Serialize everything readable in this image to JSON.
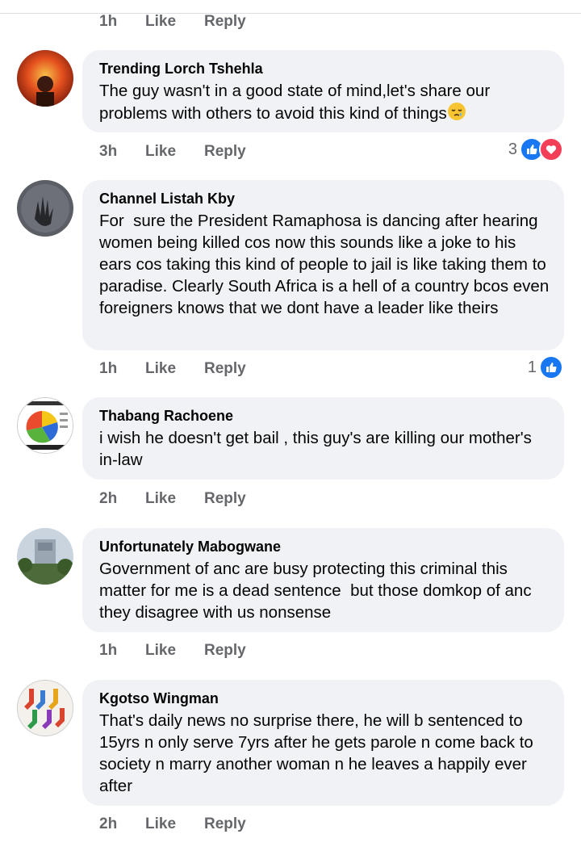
{
  "labels": {
    "like": "Like",
    "reply": "Reply"
  },
  "top_meta": {
    "time": "1h"
  },
  "comments": [
    {
      "author": "Trending Lorch Tshehla",
      "text": "The guy wasn't in a good state of mind,let's share our problems with others to avoid this kind of things",
      "time": "3h",
      "reaction_count": "3",
      "reactions": [
        "like-icon",
        "love-icon"
      ],
      "emoji": "sleepy-face"
    },
    {
      "author": "Channel Listah Kby",
      "text": "For  sure the President Ramaphosa is dancing after hearing women being killed cos now this sounds like a joke to his ears cos taking this kind of people to jail is like taking them to paradise. Clearly South Africa is a hell of a country bcos even foreigners knows that we dont have a leader like theirs",
      "time": "1h",
      "reaction_count": "1",
      "reactions": [
        "like-icon"
      ]
    },
    {
      "author": "Thabang Rachoene",
      "text": "i wish he doesn't get bail , this guy's are killing our mother's in-law",
      "time": "2h"
    },
    {
      "author": "Unfortunately Mabogwane",
      "text": "Government of anc are busy protecting this criminal this matter for me is a dead sentence  but those domkop of anc they disagree with us nonsense",
      "time": "1h"
    },
    {
      "author": "Kgotso Wingman",
      "text": "That's daily news no surprise there, he will b sentenced to 15yrs n only serve 7yrs after he gets parole n come back to society n marry another woman n he leaves a happily ever after",
      "time": "2h"
    }
  ],
  "colors": {
    "bubble": "#f0f2f5",
    "meta": "#65676b",
    "like_blue": "#1877f2",
    "love_red": "#f33e58"
  }
}
